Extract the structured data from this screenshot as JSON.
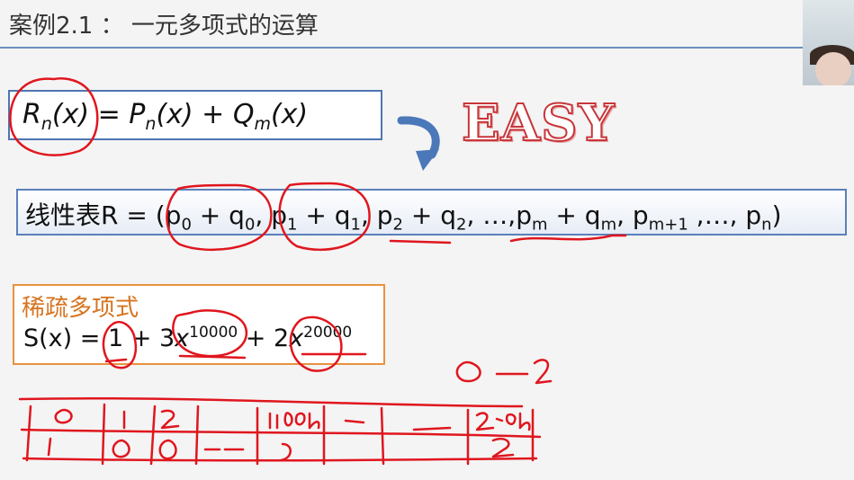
{
  "slide": {
    "title": "案例2.1 ： 一元多项式的运算",
    "formula1": {
      "R": "R",
      "n1": "n",
      "x1": "(x)",
      "eq": " = ",
      "P": "P",
      "n2": "n",
      "x2": "(x)",
      "plus": " + ",
      "Q": "Q",
      "m": "m",
      "x3": "(x)"
    },
    "easy_label": "EASY",
    "formula2": {
      "prefix": "线性表R = (",
      "terms": [
        {
          "a": "p",
          "as": "0",
          "op": " + ",
          "b": "q",
          "bs": "0",
          "sep": ", "
        },
        {
          "a": "p",
          "as": "1",
          "op": " + ",
          "b": "q",
          "bs": "1",
          "sep": ", "
        },
        {
          "a": "p",
          "as": "2",
          "op": " + ",
          "b": "q",
          "bs": "2",
          "sep": ", …,"
        },
        {
          "a": "p",
          "as": "m",
          "op": " + ",
          "b": "q",
          "bs": "m",
          "sep": ", "
        }
      ],
      "tail1": "p",
      "tail1s": "m+1",
      "ell": " ,…, ",
      "tail2": "p",
      "tail2s": "n",
      "close": ")"
    },
    "sparse": {
      "label": "稀疏多项式",
      "lhs": "S(x) = ",
      "c1": "1",
      "plus1": " + 3",
      "x1": "x",
      "e1": "10000",
      "plus2": " + 2",
      "x2": "x",
      "e2": "20000"
    }
  },
  "handwriting": {
    "note_right": "0 ~ 2",
    "table_top": [
      "0",
      "1",
      "2",
      "",
      "10000",
      "…",
      "……",
      "20000"
    ],
    "table_bottom": [
      "1",
      "0",
      "0",
      "……",
      "",
      "",
      "",
      "2"
    ]
  },
  "colors": {
    "ink": "#e0161e",
    "box_border": "#4f75b3",
    "sparse_border": "#e8923f",
    "sparse_label": "#d7741f",
    "title_rule": "#6a8fbf",
    "arrow": "#4a78b8"
  }
}
